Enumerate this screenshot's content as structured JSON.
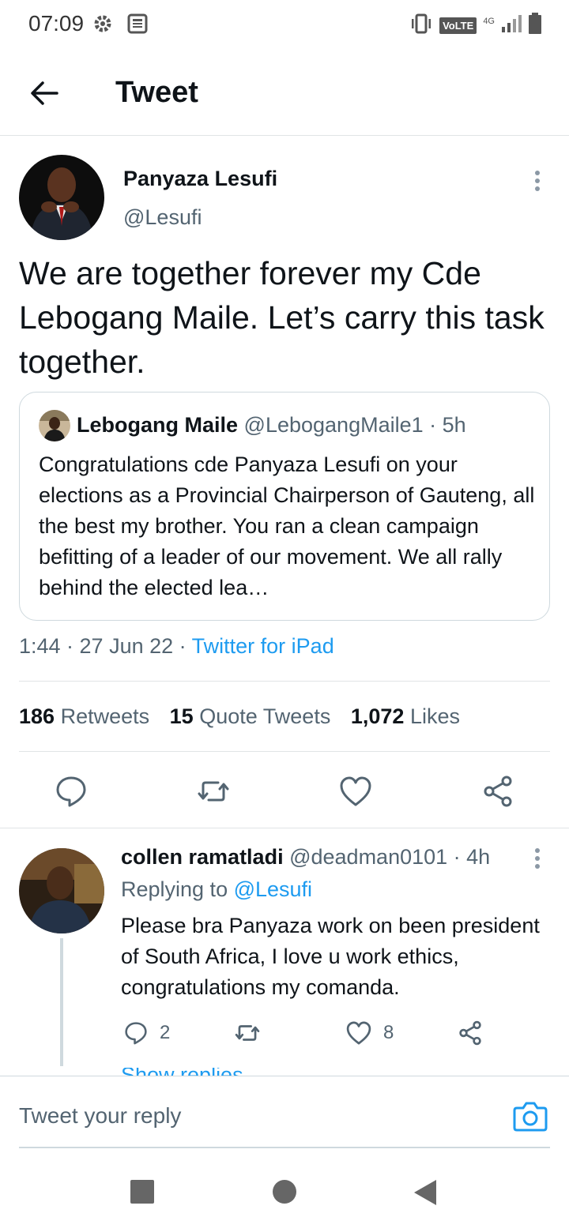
{
  "status_bar": {
    "time": "07:09",
    "network_label": "VoLTE",
    "network_type": "4G",
    "icons": [
      "gear-icon",
      "news-icon",
      "vibrate-icon",
      "signal-icon",
      "battery-icon"
    ]
  },
  "header": {
    "title": "Tweet",
    "back_icon": "arrow-left-icon"
  },
  "tweet": {
    "author_name": "Panyaza Lesufi",
    "author_handle": "@Lesufi",
    "text": "We are together forever my Cde Lebogang Maile. Let’s carry this task together.",
    "quote": {
      "author_name": "Lebogang Maile",
      "author_meta": "@LebogangMaile1 · 5h",
      "text": "Congratulations cde Panyaza Lesufi on your elections as a Provincial Chairperson of Gauteng, all the best my brother. You ran a clean campaign befitting of a leader of our movement. We all rally behind the elected lea…"
    },
    "timestamp": "1:44 · 27 Jun 22 · ",
    "source": "Twitter for iPad",
    "stats": {
      "retweets_count": "186",
      "retweets_label": "Retweets",
      "quotes_count": "15",
      "quotes_label": "Quote Tweets",
      "likes_count": "1,072",
      "likes_label": "Likes"
    },
    "actions": [
      "reply-icon",
      "retweet-icon",
      "like-icon",
      "share-icon"
    ]
  },
  "reply": {
    "author_name": "collen ramatladi",
    "author_meta": "@deadman0101 · 4h",
    "replying_to_label": "Replying to ",
    "replying_to_handle": "@Lesufi",
    "text": "Please bra Panyaza work on been president of South Africa, I love u work ethics, congratulations my comanda.",
    "reply_count": "2",
    "like_count": "8",
    "show_replies_partial": "Show replies"
  },
  "composer": {
    "placeholder": "Tweet your reply"
  },
  "colors": {
    "accent": "#1d9bf0",
    "text_primary": "#0f1419",
    "text_secondary": "#536471",
    "border": "#cfd9de"
  }
}
